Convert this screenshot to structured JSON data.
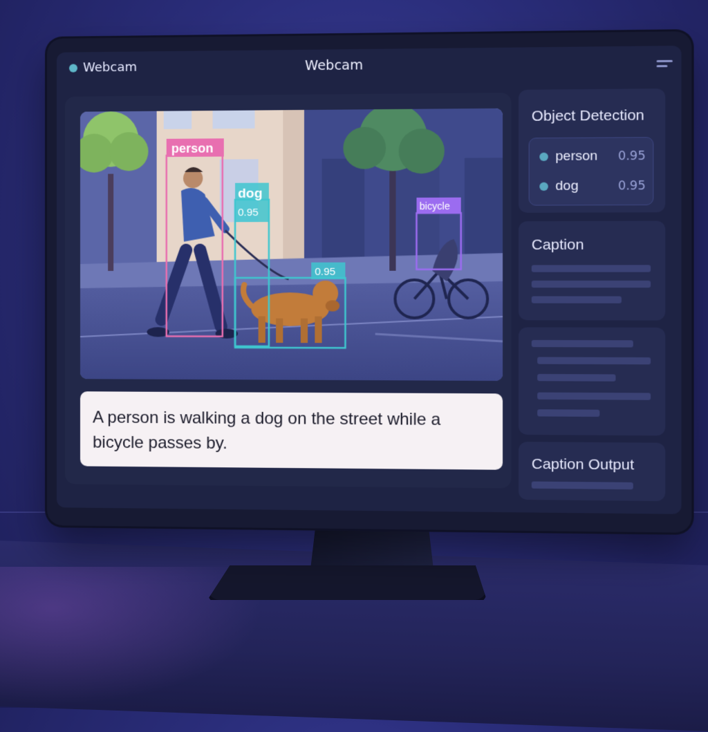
{
  "window": {
    "tab_label": "Webcam",
    "title": "Webcam"
  },
  "webcam": {
    "detections": [
      {
        "label": "person",
        "score_label": "",
        "color": "#e86fb0"
      },
      {
        "label": "dog",
        "score_label": "0.95",
        "color": "#3fc6cf"
      },
      {
        "label": "",
        "score_label": "0.95",
        "color": "#3fc6cf"
      },
      {
        "label": "bicycle",
        "score_label": "",
        "color": "#9b6cf0"
      }
    ]
  },
  "caption": {
    "text": "A person is walking a dog on the street while a bicycle passes by."
  },
  "sidebar": {
    "object_detection": {
      "title": "Object Detection",
      "items": [
        {
          "label": "person",
          "score": "0.95"
        },
        {
          "label": "dog",
          "score": "0.95"
        }
      ]
    },
    "caption_card": {
      "title": "Caption"
    },
    "caption_output_card": {
      "title": "Caption Output"
    }
  },
  "colors": {
    "accent_teal": "#3fc6cf",
    "accent_pink": "#e86fb0",
    "accent_violet": "#9b6cf0",
    "background": "#2a2d7a"
  },
  "icons": {
    "status": "status-dot-icon",
    "menu": "menu-icon"
  }
}
